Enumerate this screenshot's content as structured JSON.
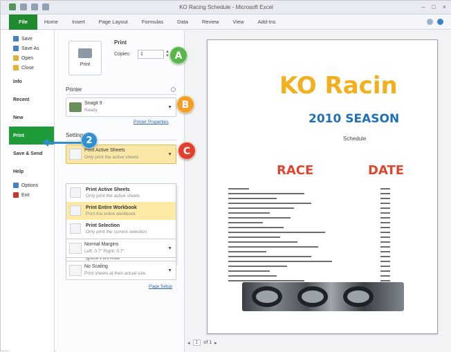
{
  "window": {
    "title": "KO Racing Schedule - Microsoft Excel",
    "controls": [
      "–",
      "□",
      "×"
    ]
  },
  "ribbon": {
    "tabs": [
      "File",
      "Home",
      "Insert",
      "Page Layout",
      "Formulas",
      "Data",
      "Review",
      "View",
      "Add-Ins"
    ]
  },
  "file_menu": {
    "small_items": [
      {
        "label": "Save",
        "icon": "save-icon"
      },
      {
        "label": "Save As",
        "icon": "save-as-icon"
      },
      {
        "label": "Open",
        "icon": "open-folder-icon"
      },
      {
        "label": "Close",
        "icon": "close-file-icon"
      }
    ],
    "big_items": [
      "Info",
      "Recent",
      "New",
      "Print",
      "Save & Send",
      "Help"
    ],
    "active": "Print",
    "bottom_items": [
      {
        "label": "Options",
        "icon": "options-icon"
      },
      {
        "label": "Exit",
        "icon": "exit-icon"
      }
    ]
  },
  "print_panel": {
    "heading": "Print",
    "button_label": "Print",
    "copies_label": "Copies:",
    "copies_value": "1",
    "printer_heading": "Printer",
    "printer_name": "Snagit 9",
    "printer_status": "Ready",
    "printer_properties_link": "Printer Properties",
    "settings_heading": "Settings",
    "settings_selected": {
      "title": "Print Active Sheets",
      "sub": "Only print the active sheets"
    },
    "settings_menu": [
      {
        "title": "Print Active Sheets",
        "sub": "Only print the active sheets"
      },
      {
        "title": "Print Entire Workbook",
        "sub": "Print the entire workbook"
      },
      {
        "title": "Print Selection",
        "sub": "Only print the current selection"
      }
    ],
    "ignore_print_area": "Ignore Print Area",
    "margins": {
      "title": "Normal Margins",
      "sub": "Left: 0.7\"   Right: 0.7\""
    },
    "scaling": {
      "title": "No Scaling",
      "sub": "Print sheets at their actual size"
    },
    "page_setup_link": "Page Setup"
  },
  "callouts": {
    "a": "A",
    "b": "B",
    "c": "C",
    "step": "2"
  },
  "preview": {
    "title": "KO Racin",
    "season": "2010 SEASON",
    "subtitle": "Schedule",
    "col_race": "RACE",
    "col_date": "DATE",
    "page_current": "1",
    "page_total": "of 1"
  },
  "colors": {
    "file_tab": "#1f8a2e",
    "active_menu": "#1e9c3a",
    "title_yellow": "#f2b01e",
    "season_blue": "#1f6fb9",
    "header_red": "#e0452e",
    "callout_green": "#58b64a",
    "callout_orange": "#f0a023",
    "callout_red": "#e2402d",
    "callout_blue": "#2f8fd0"
  }
}
